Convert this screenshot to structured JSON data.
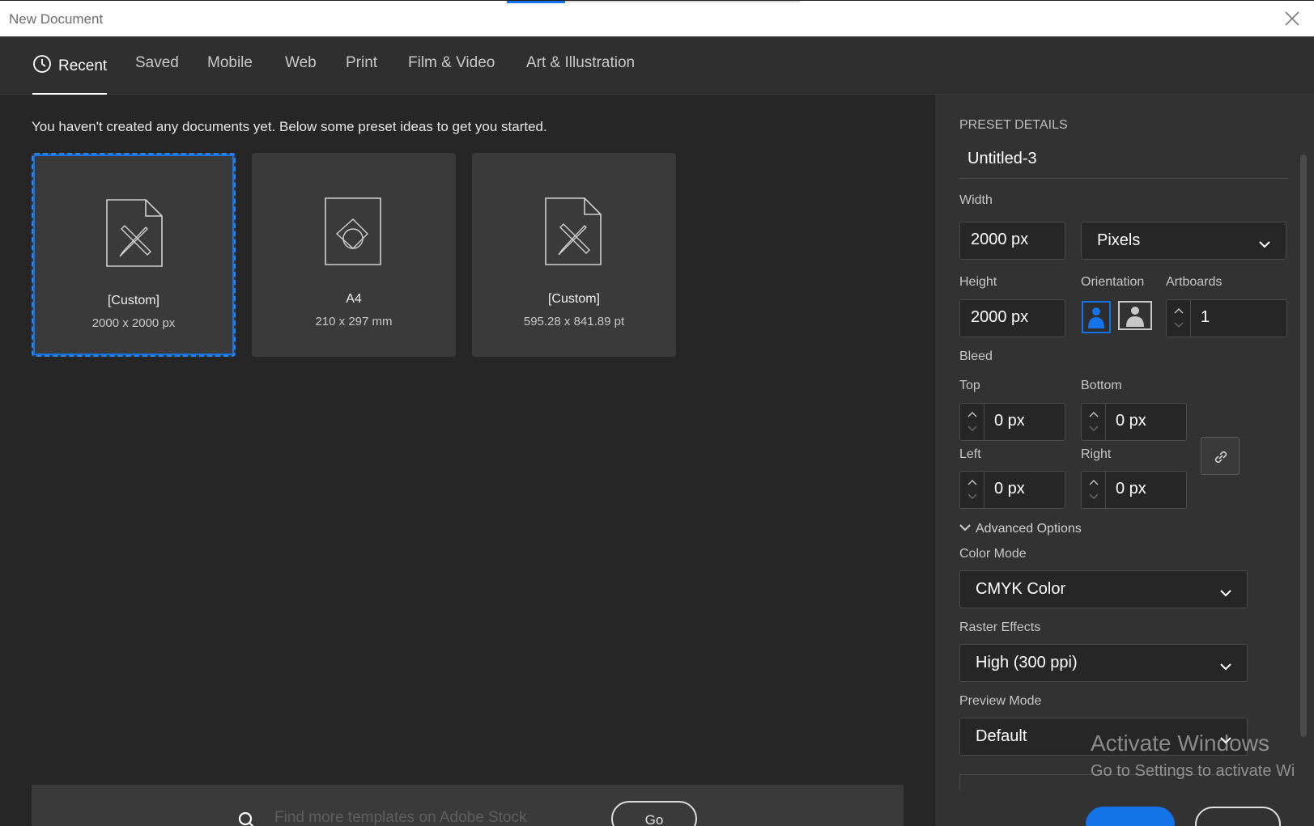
{
  "window": {
    "title": "New Document"
  },
  "tabs": [
    {
      "label": "Recent"
    },
    {
      "label": "Saved"
    },
    {
      "label": "Mobile"
    },
    {
      "label": "Web"
    },
    {
      "label": "Print"
    },
    {
      "label": "Film & Video"
    },
    {
      "label": "Art & Illustration"
    }
  ],
  "main": {
    "intro": "You haven't created any documents yet. Below some preset ideas to get you started.",
    "presets": [
      {
        "name": "[Custom]",
        "size": "2000 x 2000 px",
        "icon": "ruler-pencil-doc-icon",
        "selected": true
      },
      {
        "name": "A4",
        "size": "210 x 297 mm",
        "icon": "shapes-doc-icon",
        "selected": false
      },
      {
        "name": "[Custom]",
        "size": "595.28 x 841.89 pt",
        "icon": "ruler-pencil-doc-icon",
        "selected": false
      }
    ],
    "stock_search": {
      "placeholder": "Find more templates on Adobe Stock",
      "go_label": "Go"
    }
  },
  "details": {
    "heading": "PRESET DETAILS",
    "doc_name": "Untitled-3",
    "width_label": "Width",
    "width_value": "2000 px",
    "units": "Pixels",
    "height_label": "Height",
    "height_value": "2000 px",
    "orientation_label": "Orientation",
    "orientation_selected": "portrait",
    "artboards_label": "Artboards",
    "artboards_value": "1",
    "bleed_label": "Bleed",
    "top_label": "Top",
    "top_value": "0 px",
    "bottom_label": "Bottom",
    "bottom_value": "0 px",
    "left_label": "Left",
    "left_value": "0 px",
    "right_label": "Right",
    "right_value": "0 px",
    "advanced_label": "Advanced Options",
    "color_mode_label": "Color Mode",
    "color_mode_value": "CMYK Color",
    "raster_label": "Raster Effects",
    "raster_value": "High (300 ppi)",
    "preview_label": "Preview Mode",
    "preview_value": "Default"
  },
  "watermark": {
    "line1": "Activate Windows",
    "line2": "Go to Settings to activate Wi"
  },
  "colors": {
    "accent": "#1473e6",
    "panel": "#323232",
    "background": "#262626"
  }
}
